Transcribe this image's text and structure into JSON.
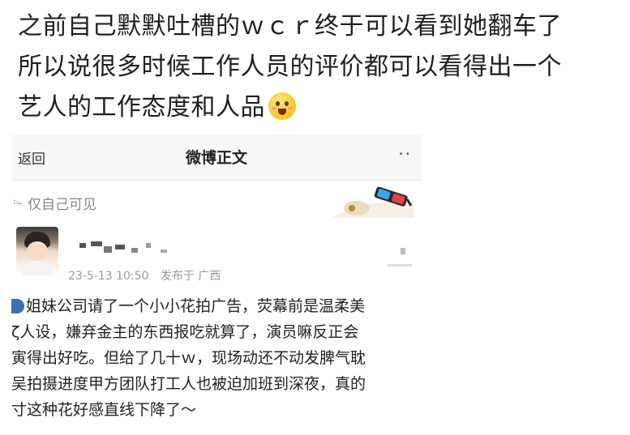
{
  "caption": {
    "lines": [
      "之前自己默默吐槽的ｗｃｒ终于可以看到她翻车了",
      "所以说很多时候工作人员的评价都可以看得出一个",
      "艺人的工作态度和人品"
    ],
    "emoji_icon": "blushing-face-emoji"
  },
  "weibo": {
    "nav": {
      "back_label": "返回",
      "title": "微博正文",
      "more_label": "··"
    },
    "visibility_label": "仅自己可见",
    "visibility_icon": "lock-icon",
    "author": {
      "avatar_icon": "child-avatar",
      "date": "23-5-13 10:50",
      "source": "发布于 广西"
    },
    "post_lines": [
      "姐妹公司请了一个小小花拍广告，荧幕前是温柔美",
      "ζ人设，嫌弃金主的东西报吃就算了，演员嘛反正会",
      "寅得出好吃。但给了几十ｗ，现场动还不动发脾气耽",
      "吴拍摄进度甲方团队打工人也被迫加班到深夜，真的",
      "寸这种花好感直线下降了～"
    ]
  }
}
